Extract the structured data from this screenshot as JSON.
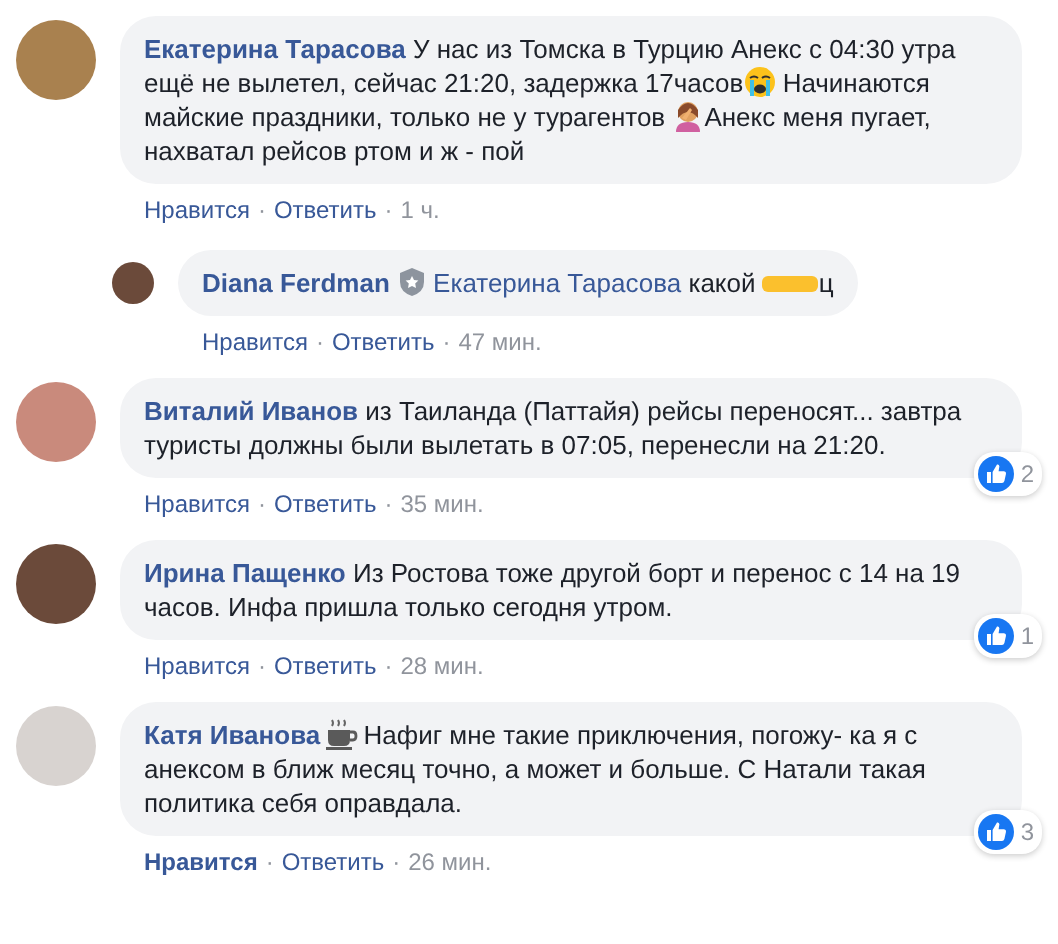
{
  "comments": [
    {
      "author": "Екатерина Тарасова",
      "body": [
        {
          "kind": "text",
          "text": "У нас из Томска в Турцию Анекс с 04:30 утра ещё не вылетел, сейчас 21:20, задержка 17часов"
        },
        {
          "kind": "crying"
        },
        {
          "kind": "text",
          "text": " Начинаются майские праздники, только не у турагентов  "
        },
        {
          "kind": "facepalm"
        },
        {
          "kind": "text",
          "text": "Анекс меня пугает, нахватал рейсов ртом и ж - пой"
        }
      ],
      "like": "Нравится",
      "liked": false,
      "separator": "·",
      "reply": "Ответить",
      "time": "1 ч.",
      "replies": [
        {
          "author": "Diana Ferdman",
          "body": [
            {
              "kind": "shield"
            },
            {
              "kind": "mention",
              "text": "Екатерина Тарасова"
            },
            {
              "kind": "text",
              "text": " какой "
            },
            {
              "kind": "redacted"
            },
            {
              "kind": "text",
              "text": "ц"
            }
          ],
          "like": "Нравится",
          "liked": false,
          "separator": "·",
          "reply": "Ответить",
          "time": "47 мин."
        }
      ]
    },
    {
      "author": "Виталий Иванов",
      "body": [
        {
          "kind": "text",
          "text": "из Таиланда (Паттайя) рейсы переносят... завтра туристы должны были вылетать в 07:05, перенесли на 21:20."
        }
      ],
      "like": "Нравится",
      "liked": false,
      "separator": "·",
      "reply": "Ответить",
      "time": "35 мин.",
      "reactions": "2"
    },
    {
      "author": "Ирина Пащенко",
      "body": [
        {
          "kind": "text",
          "text": "Из Ростова тоже другой борт и перенос с 14 на 19 часов. Инфа пришла только сегодня утром."
        }
      ],
      "like": "Нравится",
      "liked": false,
      "separator": "·",
      "reply": "Ответить",
      "time": "28 мин.",
      "reactions": "1"
    },
    {
      "author": "Катя Иванова",
      "body": [
        {
          "kind": "coffee"
        },
        {
          "kind": "text",
          "text": "Нафиг мне такие приключения, погожу- ка я с анексом в ближ месяц точно, а может и больше. С Натали такая политика себя оправдала."
        }
      ],
      "like": "Нравится",
      "liked": true,
      "separator": "·",
      "reply": "Ответить",
      "time": "26 мин.",
      "reactions": "3"
    }
  ]
}
